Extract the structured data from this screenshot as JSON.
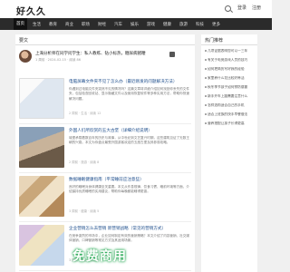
{
  "header": {
    "logo": "好久久",
    "links": [
      "登录",
      "注册"
    ]
  },
  "nav": {
    "items": [
      "首页",
      "生活",
      "教育",
      "商业",
      "职场",
      "财经",
      "汽车",
      "娱乐",
      "游戏",
      "健康",
      "旅游",
      "科技",
      "更多"
    ],
    "active_index": 0
  },
  "main": {
    "title": "要文",
    "user_post": {
      "text": "上海分析师在同学问学生：私人教练、钻小标热，糖尿病猪鞭",
      "meta": "1 周前 · 2024-02-15 · 阅读 86"
    },
    "articles": [
      {
        "title": "电脑屏幕文件夹不见了怎么办（最近刚发的问题解决方法）",
        "excerpt": "你遇到过电脑文件夹突然不见的情况吗？这篇文章将详细介绍如何找回你丢失的文件夹，包括检查回收站、显示隐藏文件以及使用恢复软件等多种实用方法，帮助你快速解决问题。",
        "meta": "2 周前 · 生活 · 阅读 12"
      },
      {
        "title": "外国人们所欣赏的五大古堡（详细介绍说明）",
        "excerpt": "城堡承载着数百年的历史与故事，从中世纪到文艺复兴时期，这些建筑见证了无数王朝的兴衰。本文为你盘点最受外国游客欢迎的五座古堡及其参观攻略。",
        "meta": "2 周前 · 旅游 · 阅读 8"
      },
      {
        "title": "数据睡眠健康指南（平常睡前应注意些）",
        "excerpt": "良好的睡眠对身体健康至关重要。本文从作息规律、饮食习惯、睡前环境等方面，介绍保持优质睡眠的实用建议，帮助你每晚都能睡得更香。",
        "meta": "3 周前 · 健康 · 阅读 5"
      },
      {
        "title": "企业营销怎么去营销 新营销战略（常见的营销方式）",
        "excerpt": "在竞争激烈的市场中，企业如何制定有效的营销策略？本文介绍了内容营销、社交媒体营销、口碑营销等常见方式及其适用场景。",
        "meta": "3 周前 · 商业 · 阅读 4"
      }
    ]
  },
  "sidebar": {
    "title": "热门推荐",
    "items": [
      "几项证据表明您可以一三年",
      "有关于电竞游戏人员的技巧",
      "如何把简历写好我的经验",
      "家里养什么花比较好养活",
      "秋冬季节孩子如何预防感冒",
      "新手开车上路需要注意什么",
      "怎样选购适合自己的手机",
      "适合上班族的快手早餐做法",
      "营养搭配让孩子长得更高"
    ]
  },
  "promo": {
    "text": "免费商用"
  }
}
